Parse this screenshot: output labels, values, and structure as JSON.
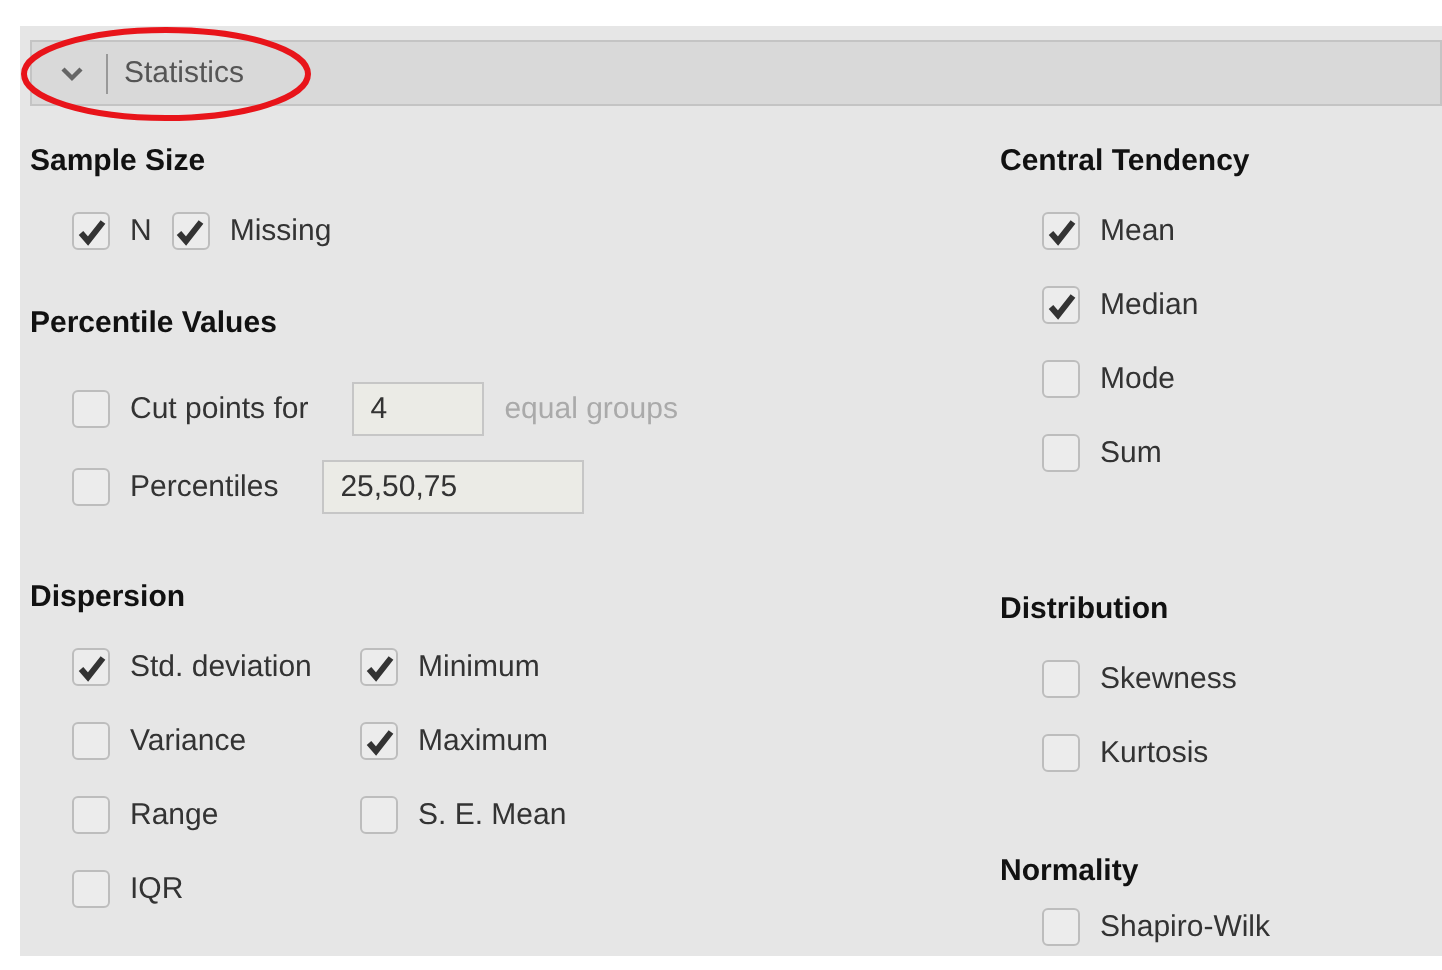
{
  "panel": {
    "title": "Statistics",
    "expanded": true
  },
  "left": [
    {
      "title": "Sample Size",
      "kind": "inline",
      "items": [
        {
          "kind": "checkbox",
          "label": "N",
          "checked": true
        },
        {
          "kind": "checkbox",
          "label": "Missing",
          "checked": true
        }
      ]
    },
    {
      "title": "Percentile Values",
      "kind": "rows",
      "items": [
        {
          "kind": "field",
          "label": "Cut points for",
          "checked": false,
          "value": "4",
          "suffix": "equal groups"
        },
        {
          "kind": "field",
          "label": "Percentiles",
          "checked": false,
          "value": "25,50,75"
        }
      ]
    },
    {
      "title": "Dispersion",
      "kind": "grid",
      "items": [
        {
          "kind": "checkbox",
          "label": "Std. deviation",
          "checked": true
        },
        {
          "kind": "checkbox",
          "label": "Minimum",
          "checked": true
        },
        {
          "kind": "checkbox",
          "label": "Variance",
          "checked": false
        },
        {
          "kind": "checkbox",
          "label": "Maximum",
          "checked": true
        },
        {
          "kind": "checkbox",
          "label": "Range",
          "checked": false
        },
        {
          "kind": "checkbox",
          "label": "S. E. Mean",
          "checked": false
        },
        {
          "kind": "checkbox",
          "label": "IQR",
          "checked": false
        }
      ]
    }
  ],
  "right": [
    {
      "title": "Central Tendency",
      "kind": "rows",
      "items": [
        {
          "kind": "checkbox",
          "label": "Mean",
          "checked": true
        },
        {
          "kind": "checkbox",
          "label": "Median",
          "checked": true
        },
        {
          "kind": "checkbox",
          "label": "Mode",
          "checked": false
        },
        {
          "kind": "checkbox",
          "label": "Sum",
          "checked": false
        }
      ]
    },
    {
      "title": "Distribution",
      "kind": "rows",
      "items": [
        {
          "kind": "checkbox",
          "label": "Skewness",
          "checked": false
        },
        {
          "kind": "checkbox",
          "label": "Kurtosis",
          "checked": false
        }
      ]
    },
    {
      "title": "Normality",
      "kind": "rows",
      "items": [
        {
          "kind": "checkbox",
          "label": "Shapiro-Wilk",
          "checked": false
        }
      ]
    }
  ]
}
